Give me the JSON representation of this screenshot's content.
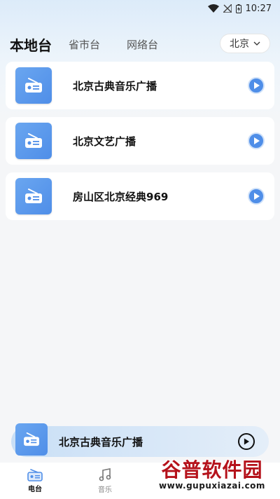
{
  "status_bar": {
    "time": "10:27"
  },
  "tabs": [
    {
      "label": "本地台",
      "active": true
    },
    {
      "label": "省市台",
      "active": false
    },
    {
      "label": "网络台",
      "active": false
    }
  ],
  "city_select": {
    "value": "北京"
  },
  "stations": [
    {
      "name": "北京古典音乐广播"
    },
    {
      "name": "北京文艺广播"
    },
    {
      "name": "房山区北京经典969"
    }
  ],
  "mini_player": {
    "title": "北京古典音乐广播"
  },
  "bottom_nav": [
    {
      "label": "电台",
      "icon": "radio-icon",
      "active": true
    },
    {
      "label": "音乐",
      "icon": "music-note-icon",
      "active": false
    }
  ],
  "watermark": {
    "main": "谷普软件园",
    "url": "www.gupuxiazai.com"
  },
  "colors": {
    "accent": "#4f8ee8",
    "accent_light": "#cfe1f9"
  }
}
